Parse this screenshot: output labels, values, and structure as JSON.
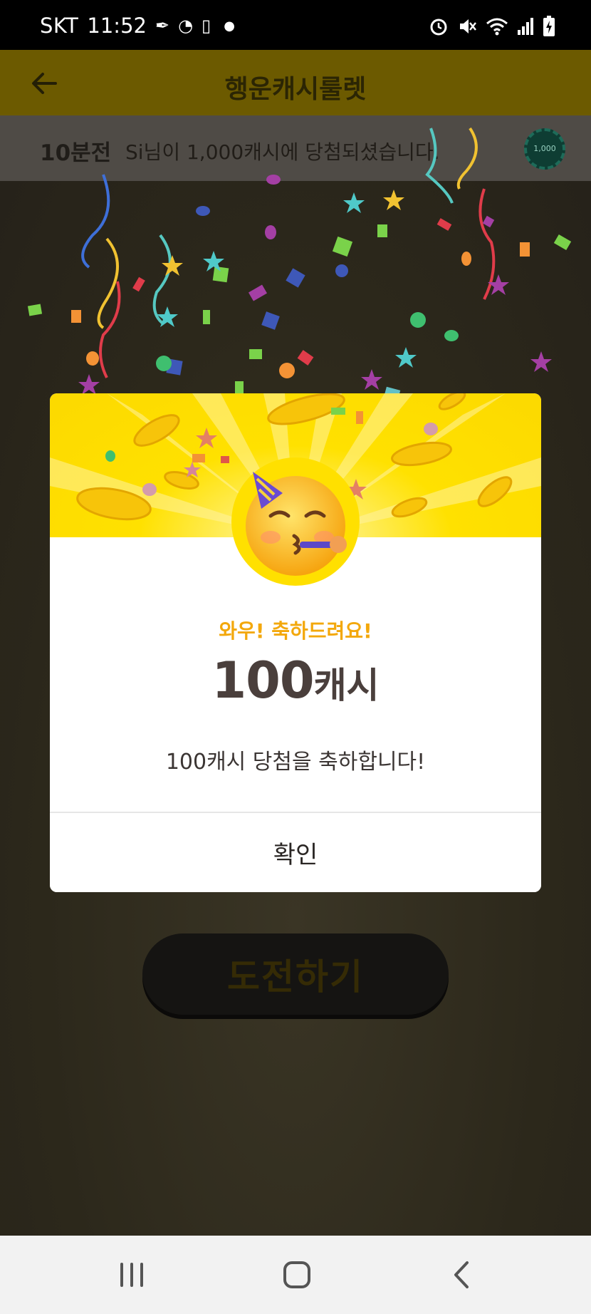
{
  "status_bar": {
    "carrier": "SKT",
    "time": "11:52",
    "left_icons": [
      "feather-icon",
      "speed-icon",
      "screen-timer-icon",
      "dot-icon"
    ],
    "right_icons": [
      "alarm-icon",
      "mute-icon",
      "wifi-icon",
      "signal-icon",
      "battery-charging-icon"
    ]
  },
  "header": {
    "title": "행운캐시룰렛",
    "back_icon": "arrow-left-icon"
  },
  "ticker": {
    "time_ago": "10분전",
    "message": "Si님이 1,000캐시에 당첨되셨습니다.",
    "chip_label": "1,000"
  },
  "background": {
    "challenge_button": "도전하기"
  },
  "modal": {
    "headline": "와우! 축하드려요!",
    "amount_number": "100",
    "amount_unit": "캐시",
    "message": "100캐시 당첨을 축하합니다!",
    "confirm_label": "확인",
    "emoji": "partying-face-icon"
  },
  "colors": {
    "banner_yellow": "#ffe100",
    "headline_orange": "#f3a80c",
    "amount_text": "#4a3f3c"
  },
  "nav_bar": {
    "buttons": [
      "recent-apps-icon",
      "home-icon",
      "back-icon"
    ]
  }
}
